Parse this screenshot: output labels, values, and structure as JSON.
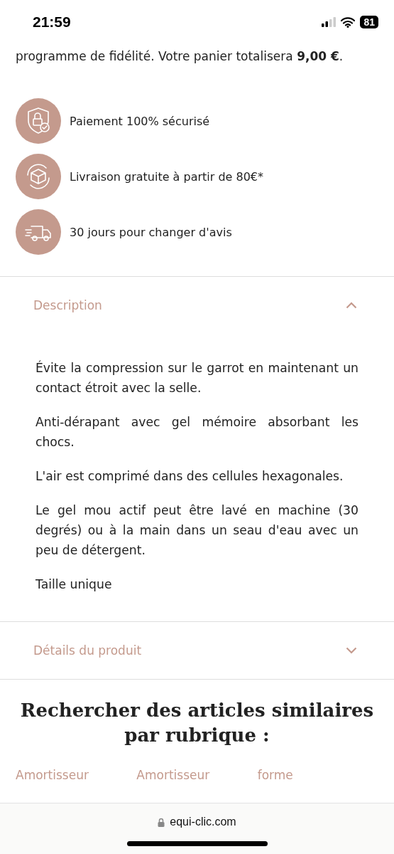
{
  "status_bar": {
    "time": "21:59",
    "battery": "81"
  },
  "intro": "programme de fidélité. Votre panier totalisera **9,00 €**.",
  "features": [
    {
      "kind": "secure",
      "label": "Paiement 100% sécurisé"
    },
    {
      "kind": "box",
      "label": "Livraison gratuite à partir de 80€*"
    },
    {
      "kind": "truck",
      "label": "30 jours pour changer d'avis"
    }
  ],
  "accordions": [
    {
      "title": "Description",
      "expanded": true,
      "paragraphs": [
        "Évite la compression sur le garrot en maintenant un contact étroit avec la selle.",
        "Anti-dérapant avec gel mémoire absorbant les chocs.",
        "L'air est comprimé dans des cellules hexagonales.",
        "Le gel mou actif peut être lavé en machine (30 degrés) ou à la main dans un seau d'eau avec un peu de détergent.",
        "Taille unique"
      ]
    },
    {
      "title": "Détails du produit",
      "expanded": false
    }
  ],
  "similar": {
    "heading": "Rechercher des articles similaires par rubrique :",
    "tags": [
      "Amortisseur",
      "Amortisseur",
      "forme"
    ]
  },
  "browser": {
    "url": "equi-clic.com"
  }
}
